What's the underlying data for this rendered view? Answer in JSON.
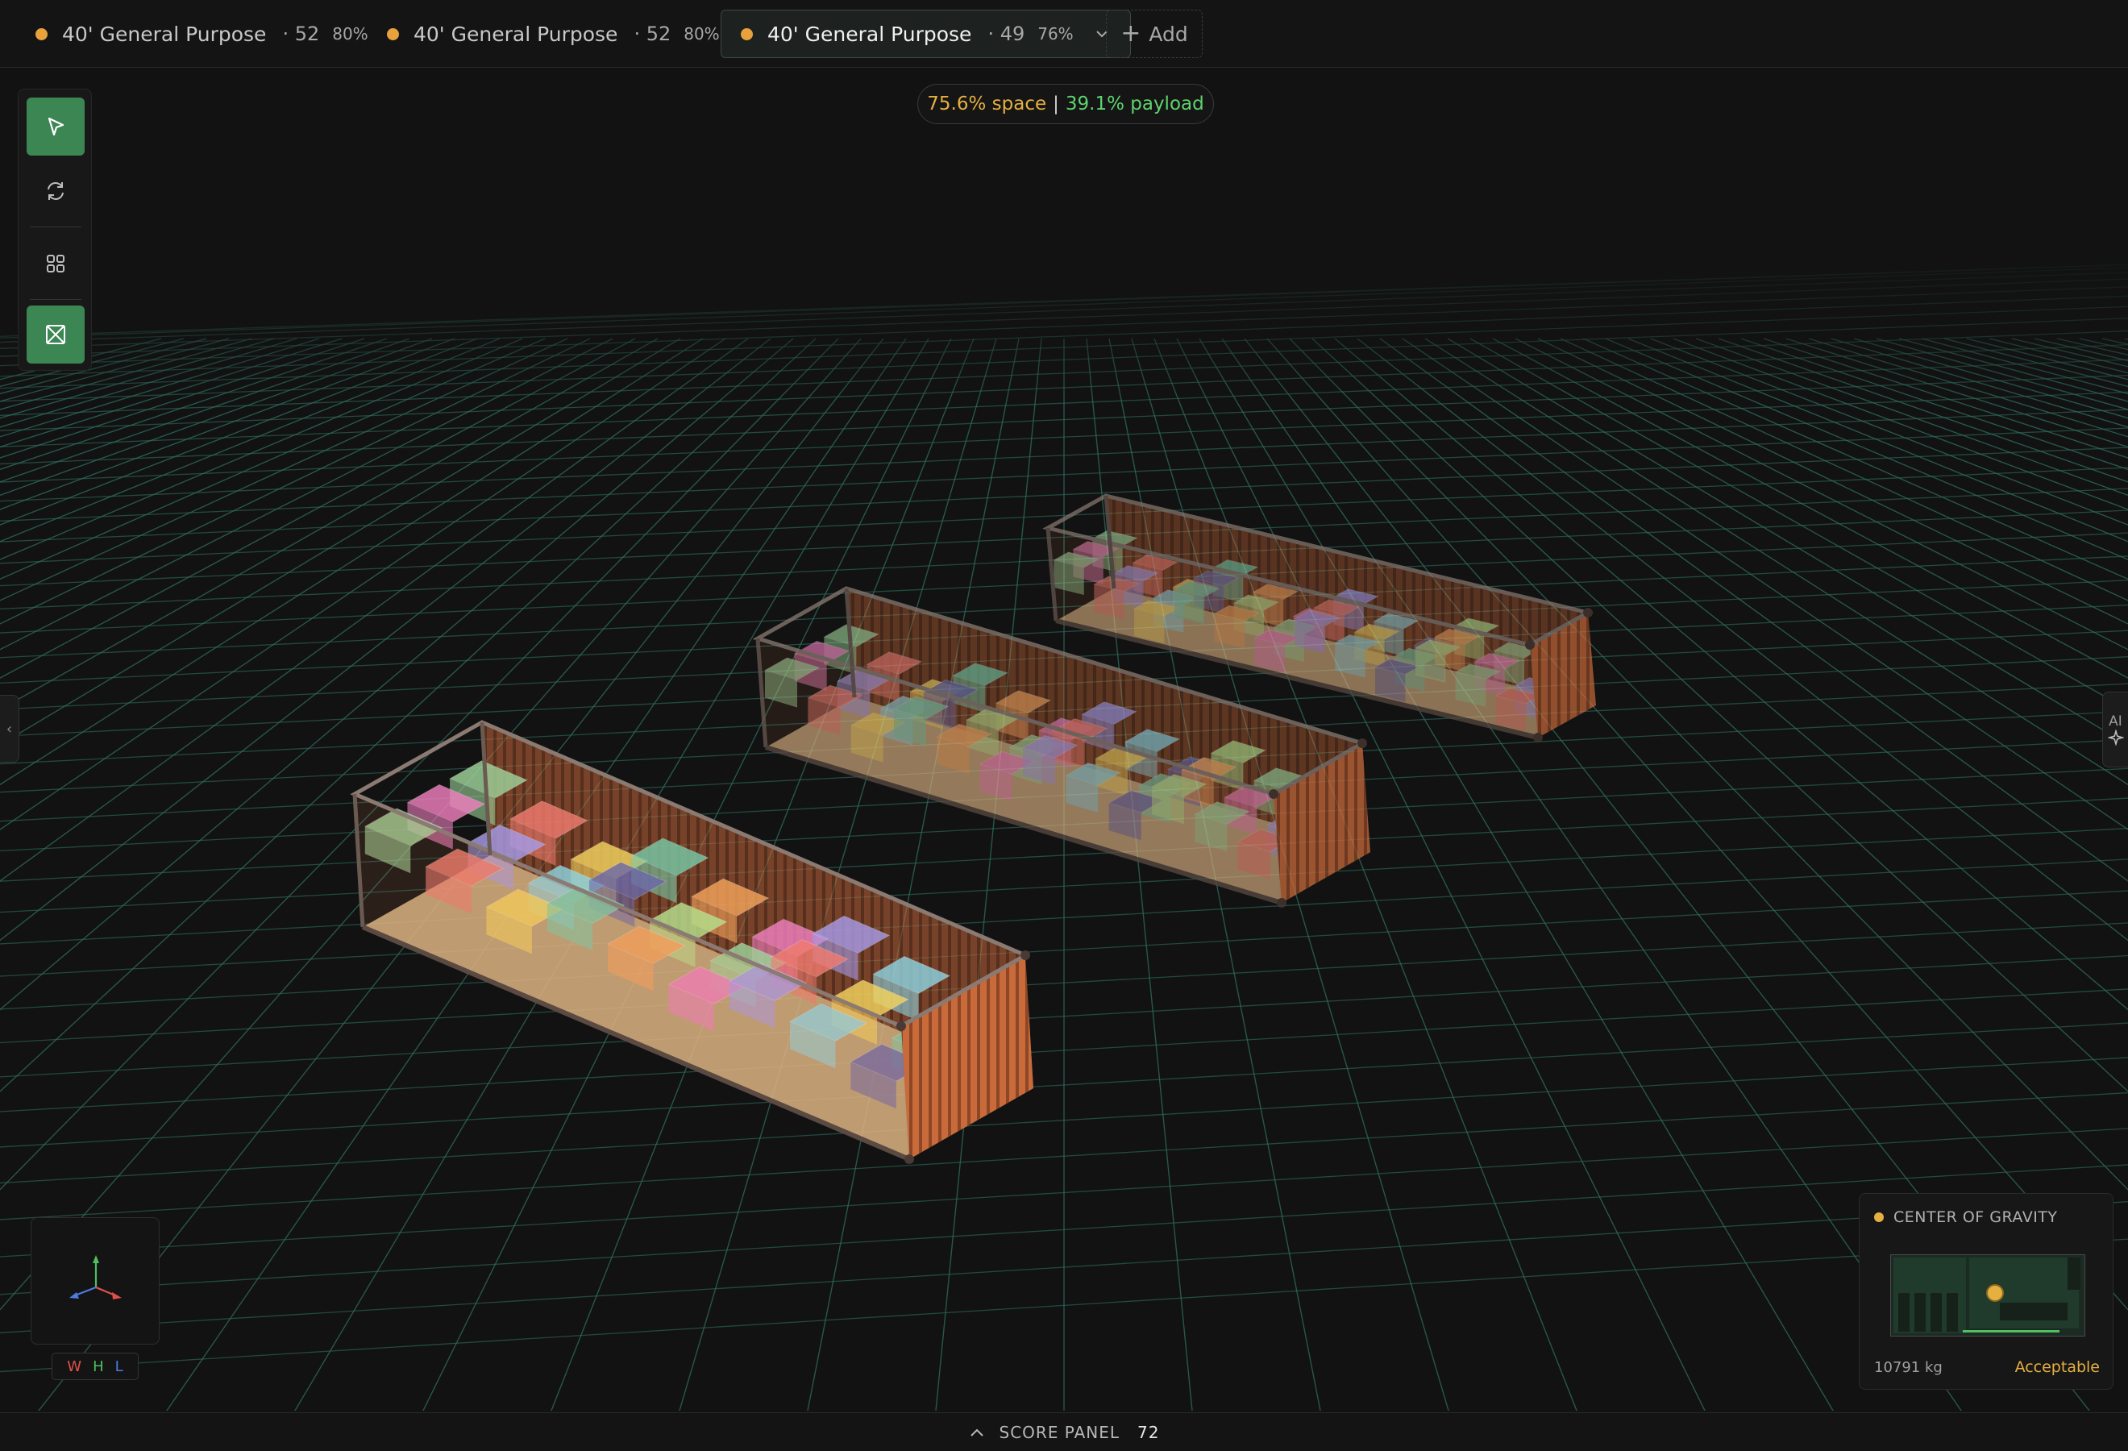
{
  "tabs": [
    {
      "label": "40' General Purpose",
      "count": "· 52",
      "percent": "80%",
      "active": false
    },
    {
      "label": "40' General Purpose",
      "count": "· 52",
      "percent": "80%",
      "active": false
    },
    {
      "label": "40' General Purpose",
      "count": "· 49",
      "percent": "76%",
      "active": true
    }
  ],
  "add_label": "Add",
  "stats": {
    "space": "75.6% space",
    "separator": "|",
    "payload": "39.1% payload"
  },
  "toolbar": {
    "tools": [
      "select-icon",
      "rotate-icon",
      "grid-view-icon",
      "container-view-icon"
    ],
    "active": [
      "select-icon",
      "container-view-icon"
    ]
  },
  "right_handle": {
    "label": "AI"
  },
  "axis_labels": {
    "w": "W",
    "h": "H",
    "l": "L"
  },
  "center_of_gravity": {
    "title": "CENTER OF GRAVITY",
    "weight": "10791 kg",
    "status": "Acceptable"
  },
  "score_panel": {
    "label": "SCORE PANEL",
    "score": "72"
  },
  "colors": {
    "accent_green": "#3c8654",
    "warning_yellow": "#e6b040",
    "payload_green": "#5fd36e",
    "tab_dot": "#e9a23b",
    "grid_line": "#2f6e5f",
    "container_orange": "#d0703c"
  }
}
